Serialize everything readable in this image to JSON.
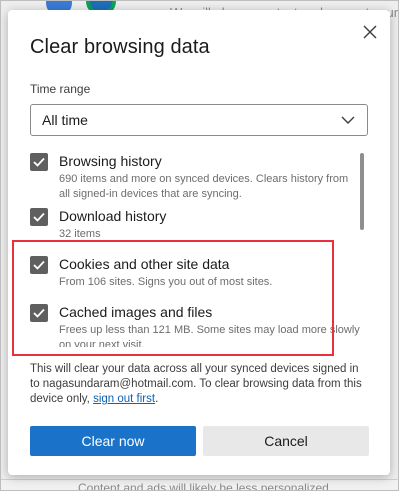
{
  "background": {
    "top_text": "We will always protect and respect your",
    "bottom_text": "Content and ads will likely be less personalized"
  },
  "dialog": {
    "title": "Clear browsing data",
    "close_icon": "close-icon",
    "time_range": {
      "label": "Time range",
      "selected": "All time"
    },
    "items": [
      {
        "title": "Browsing history",
        "description": "690 items and more on synced devices. Clears history from all signed-in devices that are syncing.",
        "checked": true
      },
      {
        "title": "Download history",
        "description": "32 items",
        "checked": true
      },
      {
        "title": "Cookies and other site data",
        "description": "From 106 sites. Signs you out of most sites.",
        "checked": true
      },
      {
        "title": "Cached images and files",
        "description": "Frees up less than 121 MB. Some sites may load more slowly on your next visit.",
        "checked": true
      }
    ],
    "sync_note": {
      "text": "This will clear your data across all your synced devices signed in to nagasundaram@hotmail.com. To clear browsing data from this device only, ",
      "link": "sign out first",
      "suffix": "."
    },
    "buttons": {
      "primary": "Clear now",
      "secondary": "Cancel"
    }
  },
  "colors": {
    "accent": "#1a73c8",
    "highlight": "#e8313d",
    "checkbox": "#5f5f5f"
  }
}
